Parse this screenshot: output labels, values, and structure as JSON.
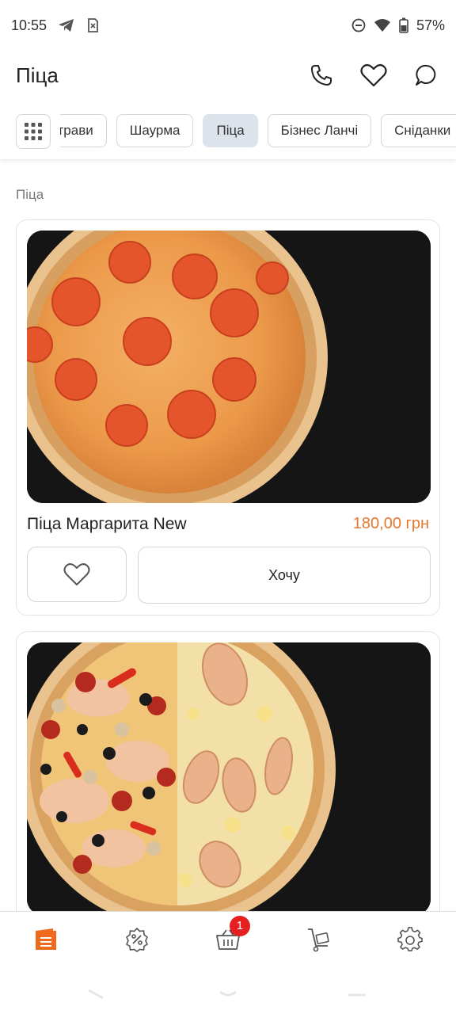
{
  "status_bar": {
    "time": "10:55",
    "battery": "57%"
  },
  "header": {
    "title": "Піца"
  },
  "categories": {
    "chips": [
      "страви",
      "Шаурма",
      "Піца",
      "Бізнес Ланчі",
      "Сніданки"
    ],
    "active_index": 2
  },
  "section": {
    "title": "Піца"
  },
  "products": [
    {
      "name": "Піца Маргарита New",
      "price": "180,00 грн",
      "want_label": "Хочу"
    },
    {
      "name": "",
      "price": "",
      "want_label": ""
    }
  ],
  "cart": {
    "badge_count": "1"
  },
  "colors": {
    "accent": "#e8772e",
    "nav_active": "#f06a1e",
    "badge": "#e52020"
  },
  "icons": {
    "header": [
      "phone-icon",
      "heart-icon",
      "chat-icon"
    ],
    "nav": [
      "menu-book-icon",
      "discount-icon",
      "basket-icon",
      "delivery-cart-icon",
      "settings-icon"
    ]
  }
}
